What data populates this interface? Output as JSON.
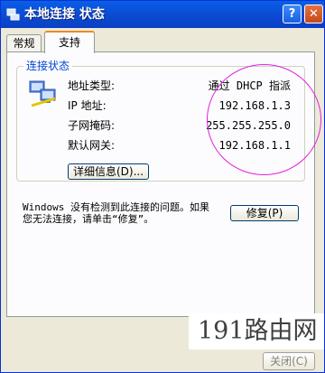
{
  "window": {
    "title": "本地连接 状态",
    "help_label": "?",
    "close_label": "✕"
  },
  "tabs": [
    {
      "label": "常规"
    },
    {
      "label": "支持"
    }
  ],
  "connection_status": {
    "group_label": "连接状态",
    "rows": [
      {
        "label": "地址类型:",
        "value": "通过 DHCP 指派"
      },
      {
        "label": "IP 地址:",
        "value": "192.168.1.3"
      },
      {
        "label": "子网掩码:",
        "value": "255.255.255.0"
      },
      {
        "label": "默认网关:",
        "value": "192.168.1.1"
      }
    ],
    "details_button": "详细信息(D)...",
    "icon": "network-connection-icon"
  },
  "repair": {
    "message_line1": "Windows 没有检测到此连接的问题。如果",
    "message_line2": "您无法连接，请单击“修复”。",
    "button": "修复(P)"
  },
  "watermark": "191路由网",
  "footer": {
    "close_button": "关闭(C)"
  },
  "colors": {
    "title_bar": "#0a5fe8",
    "annotation_circle": "#e020e0",
    "group_label": "#0046d5"
  }
}
